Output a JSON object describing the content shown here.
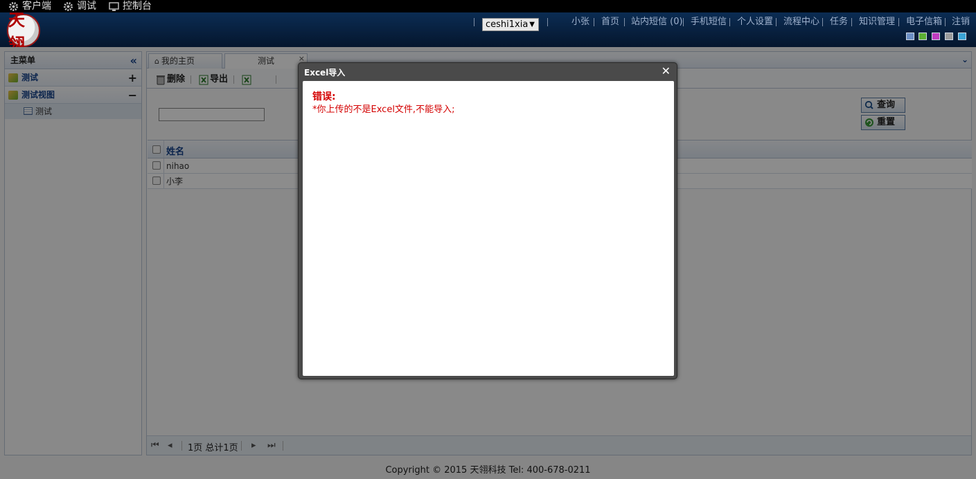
{
  "sysbar": {
    "client": "客户端",
    "debug": "调试",
    "console": "控制台"
  },
  "header": {
    "logo_text": "天翎",
    "user_select": "ceshi1xia",
    "nav": [
      "小张",
      "首页",
      "站内短信 (0)",
      "手机短信",
      "个人设置",
      "流程中心",
      "任务",
      "知识管理",
      "电子信箱",
      "注销"
    ],
    "skins": [
      "#6c8fc5",
      "#5cb033",
      "#c03bc0",
      "#9b9b9b",
      "#3aa3d6"
    ]
  },
  "sidebar": {
    "title": "主菜单",
    "groups": [
      {
        "label": "测试",
        "toggle": "+"
      },
      {
        "label": "测试视图",
        "toggle": "−"
      }
    ],
    "sub_item": "测试"
  },
  "tabs": {
    "home": "我的主页",
    "active": "测试"
  },
  "toolbar": {
    "delete": "删除",
    "export": "导出"
  },
  "search": {
    "query": "查询",
    "reset": "重置"
  },
  "grid": {
    "header": "姓名",
    "rows": [
      "nihao",
      "小李"
    ]
  },
  "pager": {
    "info": "1页 总计1页"
  },
  "footer": {
    "copyright": "Copyright © 2015 天翎科技 Tel: 400-678-0211"
  },
  "dialog": {
    "title": "Excel导入",
    "error_title": "错误:",
    "error_message": "*你上传的不是Excel文件,不能导入;"
  }
}
